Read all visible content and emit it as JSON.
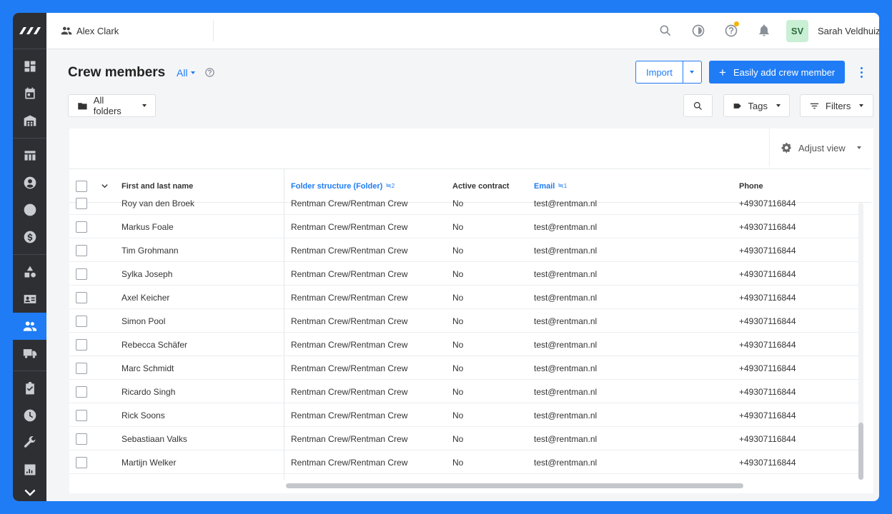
{
  "app": {
    "accent": "#1f7cf5",
    "sidebar_bg": "#2d2f33"
  },
  "topbar": {
    "workspace": "Alex Clark",
    "avatar_initials": "SV",
    "user_name": "Sarah Veldhuizen"
  },
  "header": {
    "title": "Crew members",
    "filter_label": "All",
    "import_label": "Import",
    "add_label": "Easily add crew member"
  },
  "toolbar": {
    "folders_label": "All folders",
    "tags_label": "Tags",
    "filters_label": "Filters",
    "adjust_view_label": "Adjust view"
  },
  "table": {
    "columns": {
      "name": "First and last name",
      "folder": "Folder structure (Folder)",
      "folder_sort": "2",
      "active": "Active contract",
      "email": "Email",
      "email_sort": "1",
      "phone": "Phone"
    },
    "rows": [
      {
        "name": "Roy van den Broek",
        "folder": "Rentman Crew/Rentman Crew",
        "active": "No",
        "email": "test@rentman.nl",
        "phone": "+49307116844"
      },
      {
        "name": "Markus Foale",
        "folder": "Rentman Crew/Rentman Crew",
        "active": "No",
        "email": "test@rentman.nl",
        "phone": "+49307116844"
      },
      {
        "name": "Tim Grohmann",
        "folder": "Rentman Crew/Rentman Crew",
        "active": "No",
        "email": "test@rentman.nl",
        "phone": "+49307116844"
      },
      {
        "name": "Sylka Joseph",
        "folder": "Rentman Crew/Rentman Crew",
        "active": "No",
        "email": "test@rentman.nl",
        "phone": "+49307116844"
      },
      {
        "name": "Axel Keicher",
        "folder": "Rentman Crew/Rentman Crew",
        "active": "No",
        "email": "test@rentman.nl",
        "phone": "+49307116844"
      },
      {
        "name": "Simon Pool",
        "folder": "Rentman Crew/Rentman Crew",
        "active": "No",
        "email": "test@rentman.nl",
        "phone": "+49307116844"
      },
      {
        "name": "Rebecca Schäfer",
        "folder": "Rentman Crew/Rentman Crew",
        "active": "No",
        "email": "test@rentman.nl",
        "phone": "+49307116844"
      },
      {
        "name": "Marc Schmidt",
        "folder": "Rentman Crew/Rentman Crew",
        "active": "No",
        "email": "test@rentman.nl",
        "phone": "+49307116844"
      },
      {
        "name": "Ricardo Singh",
        "folder": "Rentman Crew/Rentman Crew",
        "active": "No",
        "email": "test@rentman.nl",
        "phone": "+49307116844"
      },
      {
        "name": "Rick Soons",
        "folder": "Rentman Crew/Rentman Crew",
        "active": "No",
        "email": "test@rentman.nl",
        "phone": "+49307116844"
      },
      {
        "name": "Sebastiaan Valks",
        "folder": "Rentman Crew/Rentman Crew",
        "active": "No",
        "email": "test@rentman.nl",
        "phone": "+49307116844"
      },
      {
        "name": "Martijn Welker",
        "folder": "Rentman Crew/Rentman Crew",
        "active": "No",
        "email": "test@rentman.nl",
        "phone": "+49307116844"
      }
    ]
  },
  "sidebar": {
    "groups": [
      [
        "dashboard-icon",
        "calendar-icon",
        "warehouse-icon"
      ],
      [
        "table-icon",
        "contact-icon",
        "swap-icon",
        "dollar-icon"
      ],
      [
        "shapes-icon",
        "id-card-icon",
        "people-icon",
        "truck-icon"
      ],
      [
        "checklist-icon",
        "clock-icon",
        "wrench-icon",
        "chart-icon",
        "chevron-down-icon"
      ]
    ],
    "active": "people-icon"
  }
}
